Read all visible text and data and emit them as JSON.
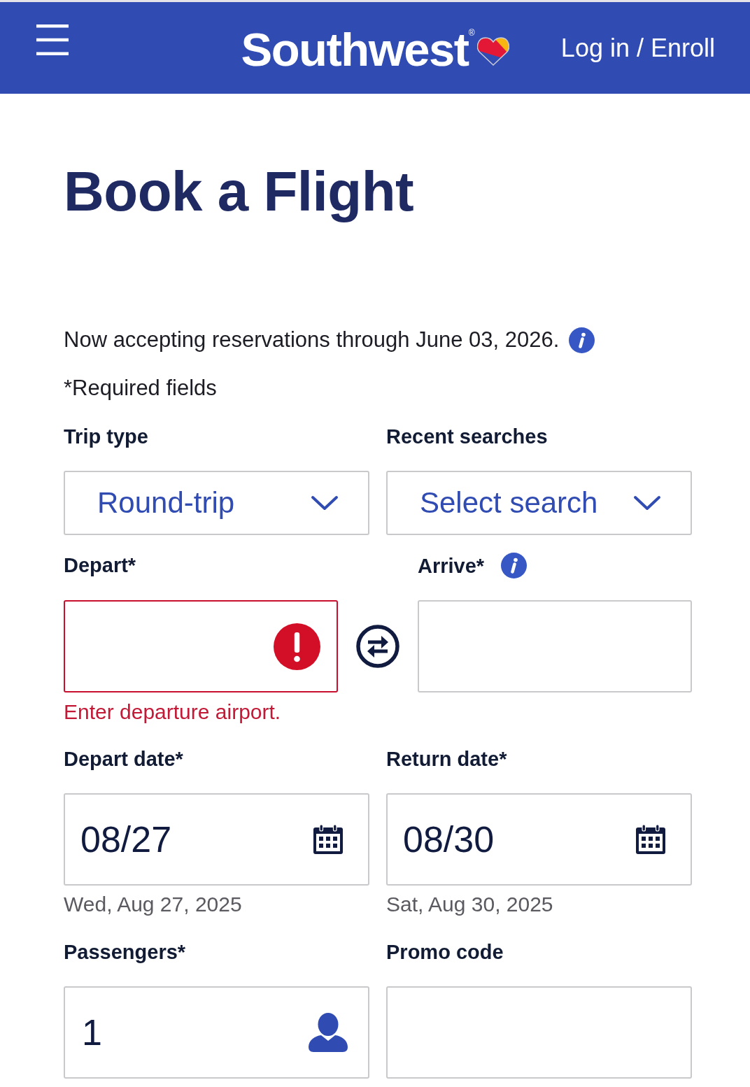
{
  "header": {
    "logo": "Southwest$^{®}$",
    "login_link": "Log in / Enroll"
  },
  "page_title": "Book a Flight",
  "notice": "Now accepting reservations through June 03, 2026.",
  "required_note": "*Required fields",
  "form": {
    "trip_type": {
      "label": "Trip type",
      "value": "Round-trip"
    },
    "recent_searches": {
      "label": "Recent searches",
      "value": "Select search"
    },
    "depart": {
      "label": "Depart*",
      "invalid": true,
      "error_message": "Enter departure airport."
    },
    "arrive": {
      "label": "Arrive*",
      "invalid": false
    },
    "depart_date": {
      "label": "Depart date*",
      "value": "08/27",
      "caption": "Wed, Aug 27, 2025"
    },
    "return_date": {
      "label": "Return date*",
      "value": "08/30",
      "caption": "Sat, Aug 30, 2025"
    },
    "passengers": {
      "label": "Passengers*",
      "value": "1"
    },
    "promo_code": {
      "label": "Promo code"
    }
  }
}
